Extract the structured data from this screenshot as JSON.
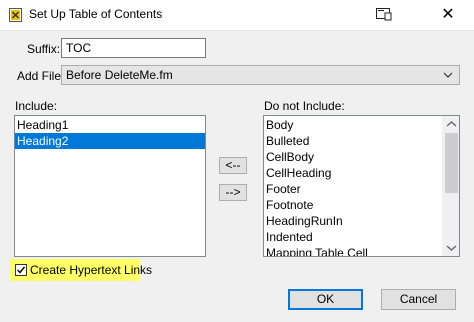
{
  "window": {
    "title": "Set Up Table of Contents",
    "close_glyph": "✕"
  },
  "form": {
    "suffix_label": "Suffix:",
    "suffix_value": "TOC",
    "add_file_label": "Add File:",
    "add_file_value": "Before DeleteMe.fm"
  },
  "include": {
    "label": "Include:",
    "items": [
      "Heading1",
      "Heading2"
    ],
    "selected": "Heading2"
  },
  "exclude": {
    "label": "Do not Include:",
    "items": [
      "Body",
      "Bulleted",
      "CellBody",
      "CellHeading",
      "Footer",
      "Footnote",
      "HeadingRunIn",
      "Indented",
      "Mapping Table Cell"
    ]
  },
  "move_buttons": {
    "left": "<--",
    "right": "-->"
  },
  "options": {
    "hypertext_label": "Create Hypertext Links",
    "hypertext_checked": true
  },
  "actions": {
    "ok": "OK",
    "cancel": "Cancel"
  },
  "colors": {
    "highlight": "#ffff66",
    "selection": "#0078d7",
    "default_button_border": "#0078d7"
  },
  "icons": [
    "app-icon",
    "help-icon",
    "close-icon",
    "chevron-down-icon",
    "scroll-up-icon",
    "scroll-down-icon",
    "checkmark-icon"
  ]
}
